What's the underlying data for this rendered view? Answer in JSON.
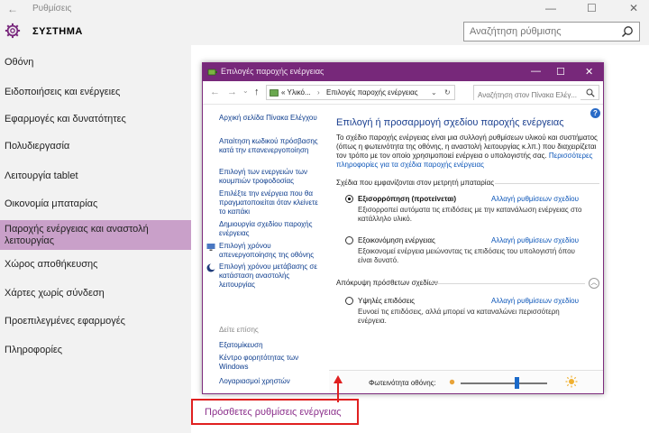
{
  "window": {
    "title": "Ρυθμίσεις",
    "back_glyph": "←",
    "min_glyph": "—",
    "max_glyph": "☐",
    "close_glyph": "✕"
  },
  "header": {
    "title": "ΣΥΣΤΗΜΑ",
    "search_placeholder": "Αναζήτηση ρύθμισης",
    "icon": "gear-icon",
    "accent": "#7a2a7e"
  },
  "sidebar": {
    "items": [
      {
        "label": "Οθόνη"
      },
      {
        "label": "Ειδοποιήσεις και ενέργειες"
      },
      {
        "label": "Εφαρμογές και δυνατότητες"
      },
      {
        "label": "Πολυδιεργασία"
      },
      {
        "label": "Λειτουργία tablet"
      },
      {
        "label": "Οικονομία μπαταρίας"
      },
      {
        "label": "Παροχής ενέργειας και αναστολή λειτουργίας"
      },
      {
        "label": "Χώρος αποθήκευσης"
      },
      {
        "label": "Χάρτες χωρίς σύνδεση"
      },
      {
        "label": "Προεπιλεγμένες εφαρμογές"
      },
      {
        "label": "Πληροφορίες"
      }
    ],
    "active_index": 6,
    "active_color": "#c9a0c9"
  },
  "control_panel": {
    "title": "Επιλογές παροχής ενέργειας",
    "breadcrumb": [
      "« Υλικό...",
      "›",
      "Επιλογές παροχής ενέργειας"
    ],
    "search_placeholder": "Αναζήτηση στον Πίνακα Ελέγ...",
    "help": "?",
    "left_links": [
      "Αρχική σελίδα Πίνακα Ελέγχου",
      "Απαίτηση κωδικού πρόσβασης κατά την επανενεργοποίηση",
      "Επιλογή των ενεργειών των κουμπιών τροφοδοσίας",
      "Επιλέξτε την ενέργεια που θα πραγματοποιείται όταν κλείνετε το καπάκι",
      "Δημιουργία σχεδίου παροχής ενέργειας",
      "Επιλογή χρόνου απενεργοποίησης της οθόνης",
      "Επιλογή χρόνου μετάβασης σε κατάσταση αναστολής λειτουργίας"
    ],
    "see_also": "Δείτε επίσης",
    "see_also_links": [
      "Εξατομίκευση",
      "Κέντρο φορητότητας των Windows",
      "Λογαριασμοί χρηστών"
    ],
    "main_title": "Επιλογή ή προσαρμογή σχεδίου παροχής ενέργειας",
    "intro": "Το σχέδιο παροχής ενέργειας είναι μια συλλογή ρυθμίσεων υλικού και συστήματος (όπως η φωτεινότητα της οθόνης, η αναστολή λειτουργίας κ.λπ.) που διαχειρίζεται τον τρόπο με τον οποίο χρησιμοποιεί ενέργεια ο υπολογιστής σας.",
    "intro_link": "Περισσότερες πληροφορίες για τα σχέδια παροχής ενέργειας",
    "battery_section": "Σχέδια που εμφανίζονται στον μετρητή μπαταρίας",
    "plans": [
      {
        "name": "Εξισορρόπηση (προτείνεται)",
        "selected": true,
        "change": "Αλλαγή ρυθμίσεων σχεδίου",
        "desc": "Εξισορροπεί αυτόματα τις επιδόσεις με την κατανάλωση ενέργειας στο κατάλληλο υλικό."
      },
      {
        "name": "Εξοικονόμηση ενέργειας",
        "selected": false,
        "change": "Αλλαγή ρυθμίσεων σχεδίου",
        "desc": "Εξοικονομεί ενέργεια μειώνοντας τις επιδόσεις του υπολογιστή όπου είναι δυνατό."
      }
    ],
    "hidden_section": "Απόκρυψη πρόσθετων σχεδίων",
    "hidden_plans": [
      {
        "name": "Υψηλές επιδόσεις",
        "selected": false,
        "change": "Αλλαγή ρυθμίσεων σχεδίου",
        "desc": "Ευνοεί τις επιδόσεις, αλλά μπορεί να καταναλώνει περισσότερη ενέργεια."
      }
    ],
    "brightness_label": "Φωτεινότητα οθόνης:",
    "brightness_level": 0.65
  },
  "extra_link": "Πρόσθετες ρυθμίσεις ενέργειας",
  "highlight_color": "#e02020"
}
